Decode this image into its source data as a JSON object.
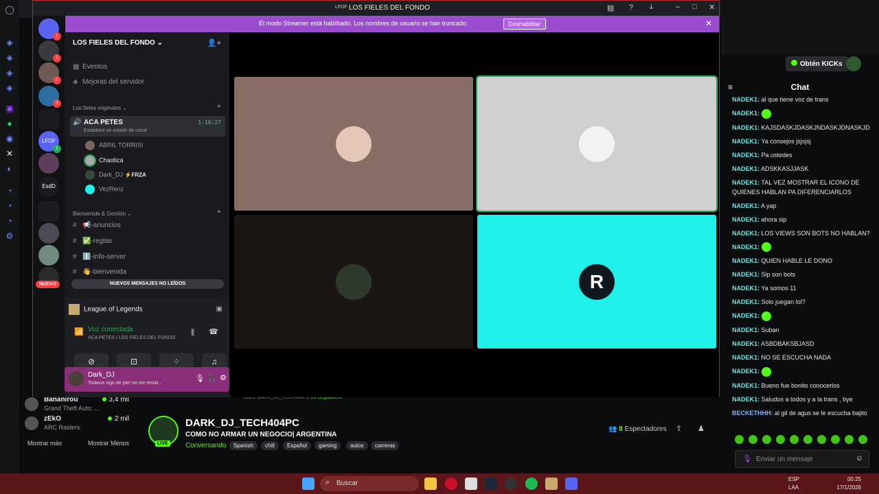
{
  "discord": {
    "window_title": "LOS FIELES DEL FONDO",
    "titlebar_logo": "LFDF",
    "banner": {
      "text": "El modo Streamer está habilitado. Los nombres de usuario se han truncado.",
      "button": "Deshabilitar"
    },
    "guilds": [
      {
        "label": "",
        "badge": "1"
      },
      {
        "label": "",
        "badge": "1"
      },
      {
        "label": "",
        "badge": "1"
      },
      {
        "label": "",
        "badge": "3"
      },
      {
        "label": "LFDF",
        "badge": "1"
      },
      {
        "label": "EsdD",
        "badge": ""
      }
    ],
    "new_badge": "NUEVO",
    "server_name": "LOS FIELES DEL FONDO",
    "top_items": [
      "Eventos",
      "Mejoras del servidor"
    ],
    "categories": {
      "first": "Los fieles originales",
      "second": "Bienvenida & Gestión"
    },
    "voice_channel": {
      "name": "ACA PETES",
      "status": "Establece un estado de canal",
      "time": "1:16:27"
    },
    "voice_users": [
      {
        "name": "ABRIL TORRISI",
        "tag": ""
      },
      {
        "name": "Chaotica",
        "tag": ""
      },
      {
        "name": "Dark_DJ",
        "tag": "⚡FRZA"
      },
      {
        "name": "VezRenz",
        "tag": ""
      }
    ],
    "text_channels": [
      "📢-anuncios",
      "✅-reglas",
      "ℹ️-info-server",
      "👋-bienvenida"
    ],
    "new_messages": "NUEVOS MENSAJES NO LEÍDOS",
    "activity": "League of Legends",
    "voice_connected": "Voz conectada",
    "voice_location": "ACA PETES / LOS FIELES DEL FONDO",
    "user": {
      "name": "Dark_DJ",
      "status": "Todavia sigo de pie! no me rendir..."
    }
  },
  "kick": {
    "recommended": [
      {
        "name": "Bananirou",
        "game": "Grand Theft Auto: ...",
        "viewers": "3,4 mil"
      },
      {
        "name": "zEkO",
        "game": "ARC Raiders",
        "viewers": "2 mil"
      }
    ],
    "show_more": "Mostrar más",
    "show_less": "Mostrar Menos",
    "about": "Sobre DARK_DJ_TECH404PC",
    "followers": "26 Seguidores",
    "streamer": "DARK_DJ_TECH404PC",
    "live": "LIVE",
    "title": "COMO NO ARMAR UN NEGOCIO| ARGENTINA",
    "category": "Conversando",
    "tags": [
      "Spanish",
      "chill",
      "Español",
      "gaming",
      "autos",
      "carreras"
    ],
    "viewers_count": "8",
    "viewers_label": "Espectadores",
    "kicks_button": "Obtén KICKs",
    "chat_title": "Chat",
    "chat_placeholder": "Enviar un mensaje",
    "messages": [
      {
        "user": "NADEK1:",
        "text": "al que tiene voz de trans"
      },
      {
        "user": "NADEK1:",
        "text": ""
      },
      {
        "user": "NADEK1:",
        "text": "KAJSDASKJDASKJNDASKJDNASKJD"
      },
      {
        "user": "NADEK1:",
        "text": "Ya consejos jsjsjsj"
      },
      {
        "user": "NADEK1:",
        "text": "Pa ustedes"
      },
      {
        "user": "NADEK1:",
        "text": "ADSKKASJJASK"
      },
      {
        "user": "NADEK1:",
        "text": "TAL VEZ MOSTRAR EL ICONO DE QUIENES HABLAN PA DIFERENCIARLOS"
      },
      {
        "user": "NADEK1:",
        "text": "A yap"
      },
      {
        "user": "NADEK1:",
        "text": "ahora sip"
      },
      {
        "user": "NADEK1:",
        "text": "LOS VIEWS SON BOTS NO HABLAN?"
      },
      {
        "user": "NADEK1:",
        "text": ""
      },
      {
        "user": "NADEK1:",
        "text": "QUIEN HABLE LE DONO"
      },
      {
        "user": "NADEK1:",
        "text": "Sip son bots"
      },
      {
        "user": "NADEK1:",
        "text": "Ya somos 11"
      },
      {
        "user": "NADEK1:",
        "text": "Solo juegan lol?"
      },
      {
        "user": "NADEK1:",
        "text": ""
      },
      {
        "user": "NADEK1:",
        "text": "Suban"
      },
      {
        "user": "NADEK1:",
        "text": "ASBDBAKSBJASD"
      },
      {
        "user": "NADEK1:",
        "text": "NO SE ESCUCHA NADA"
      },
      {
        "user": "NADEK1:",
        "text": ""
      },
      {
        "user": "NADEK1:",
        "text": "Bueno fue bonito conocerlos"
      },
      {
        "user": "NADEK1:",
        "text": "Saludos a todos y a la trans , bye"
      },
      {
        "user": "BECKETHHH:",
        "text": "al gil de agus se le escucha bajito"
      }
    ]
  },
  "taskbar": {
    "search": "Buscar",
    "lang": "ESP",
    "lang2": "LAA",
    "time": "00:25",
    "date": "17/1/2026"
  },
  "colors": {
    "kick_green": "#53fc18",
    "discord_banner": "#9b4dcf",
    "taskbar": "#5a1618"
  }
}
